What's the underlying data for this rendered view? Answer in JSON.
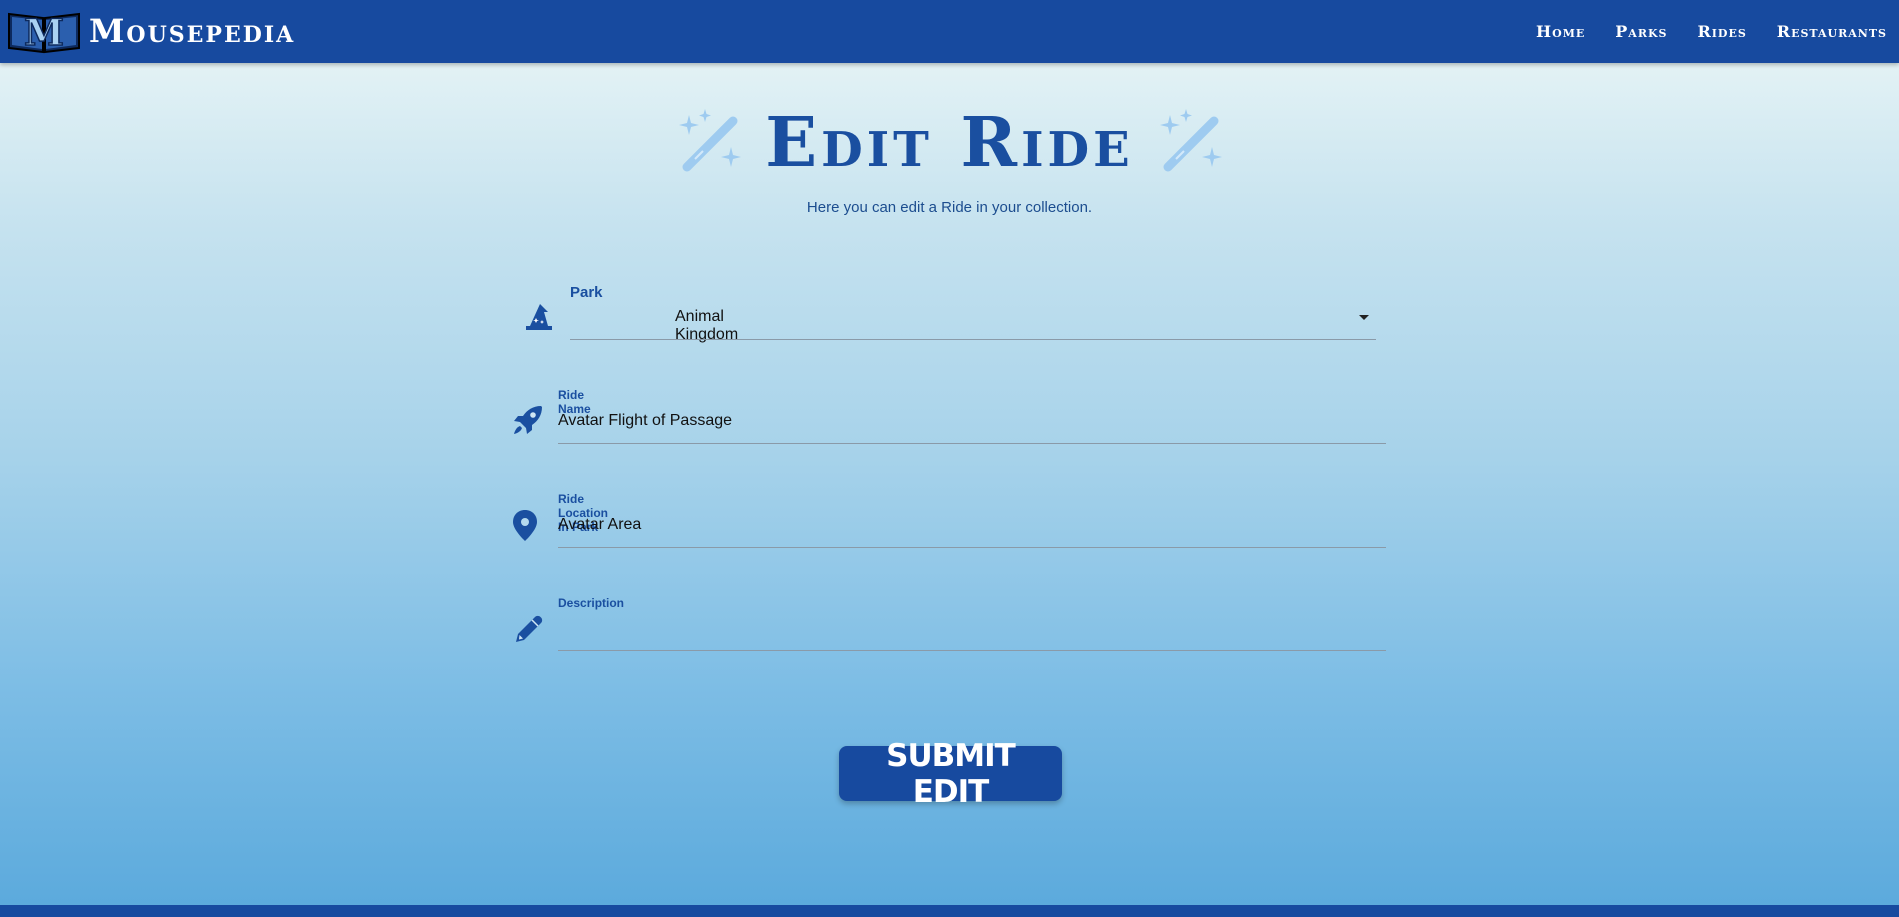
{
  "brand": {
    "logo_letter": "M",
    "name": "Mousepedia"
  },
  "nav": {
    "items": [
      {
        "label": "Home"
      },
      {
        "label": "Parks"
      },
      {
        "label": "Rides"
      },
      {
        "label": "Restaurants"
      }
    ]
  },
  "header": {
    "title": "Edit Ride",
    "subtitle": "Here you can edit a Ride in your collection."
  },
  "form": {
    "park": {
      "label": "Park",
      "value": "Animal Kingdom",
      "icon": "wizard-hat-icon"
    },
    "ride_name": {
      "label": "Ride Name",
      "value": "Avatar Flight of Passage",
      "icon": "rocket-icon"
    },
    "location": {
      "label": "Ride Location In Park",
      "value": "Avatar Area",
      "icon": "map-pin-icon"
    },
    "description": {
      "label": "Description",
      "value": "",
      "icon": "pencil-icon"
    },
    "submit_label": "SUBMIT EDIT"
  },
  "colors": {
    "navbar": "#174a9f",
    "title": "#1a4fa0",
    "wand": "#9ecbf0",
    "button": "#174a9f"
  }
}
